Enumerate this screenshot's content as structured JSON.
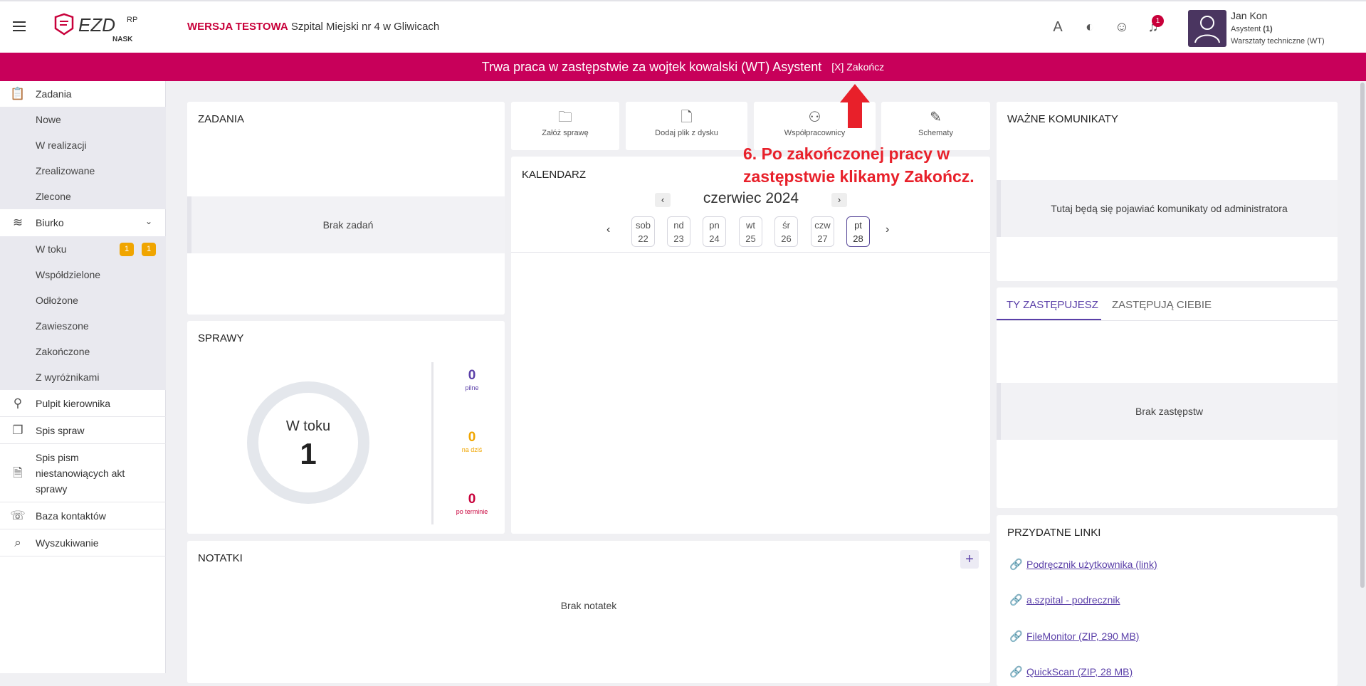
{
  "header": {
    "logo_text": "EZD",
    "logo_sup": "RP",
    "logo_sub": "NASK",
    "version_label": "WERSJA TESTOWA",
    "institution": "Szpital Miejski nr 4 w Gliwicach",
    "notifications_count": "1",
    "user_name": "Jan Kon",
    "user_role": "Asystent",
    "user_role_num": "(1)",
    "user_unit": "Warsztaty techniczne (WT)"
  },
  "banner": {
    "text": "Trwa praca w zastępstwie za wojtek kowalski (WT) Asystent",
    "end_label": "[X] Zakończ"
  },
  "sidebar": {
    "zadania": "Zadania",
    "zadania_sub": [
      "Nowe",
      "W realizacji",
      "Zrealizowane",
      "Zlecone"
    ],
    "biurko": "Biurko",
    "biurko_sub": [
      "W toku",
      "Współdzielone",
      "Odłożone",
      "Zawieszone",
      "Zakończone",
      "Z wyróżnikami"
    ],
    "wtoku_count1": "1",
    "wtoku_count2": "1",
    "pulpit": "Pulpit kierownika",
    "spis_spraw": "Spis spraw",
    "spis_pism_1": "Spis pism",
    "spis_pism_2": "niestanowiących akt",
    "spis_pism_3": "sprawy",
    "baza": "Baza kontaktów",
    "szukaj": "Wyszukiwanie"
  },
  "zadania_card": {
    "title": "ZADANIA",
    "empty": "Brak zadań"
  },
  "sprawy_card": {
    "title": "SPRAWY",
    "donut_label": "W toku",
    "donut_value": "1",
    "pilne": "0",
    "pilne_label": "pilne",
    "na_dzis": "0",
    "na_dzis_label": "na dziś",
    "po_terminie": "0",
    "po_terminie_label": "po terminie"
  },
  "quick_actions": [
    "Załóż sprawę",
    "Dodaj plik z dysku",
    "Współpracownicy",
    "Schematy"
  ],
  "annotation": {
    "line1": "6. Po zakończonej pracy w",
    "line2": "zastępstwie klikamy Zakończ."
  },
  "calendar": {
    "title": "KALENDARZ",
    "month": "czerwiec 2024",
    "days": [
      {
        "name": "sob",
        "num": "22"
      },
      {
        "name": "nd",
        "num": "23"
      },
      {
        "name": "pn",
        "num": "24"
      },
      {
        "name": "wt",
        "num": "25"
      },
      {
        "name": "śr",
        "num": "26"
      },
      {
        "name": "czw",
        "num": "27"
      },
      {
        "name": "pt",
        "num": "28"
      }
    ]
  },
  "notatki": {
    "title": "NOTATKI",
    "empty": "Brak notatek",
    "add": "+"
  },
  "komunikaty": {
    "title": "WAŻNE KOMUNIKATY",
    "text": "Tutaj będą się pojawiać komunikaty od administratora"
  },
  "zastepstwa": {
    "tab1": "TY ZASTĘPUJESZ",
    "tab2": "ZASTĘPUJĄ CIEBIE",
    "empty": "Brak zastępstw"
  },
  "linki": {
    "title": "PRZYDATNE LINKI",
    "items": [
      "Podręcznik użytkownika (link)",
      "a.szpital - podrecznik",
      "FileMonitor (ZIP, 290 MB)",
      "QuickScan (ZIP, 28 MB)"
    ]
  },
  "colors": {
    "accent": "#c8005a",
    "brand_red": "#c8003a",
    "purple": "#5a3fa8",
    "annotation_red": "#e8202a"
  }
}
